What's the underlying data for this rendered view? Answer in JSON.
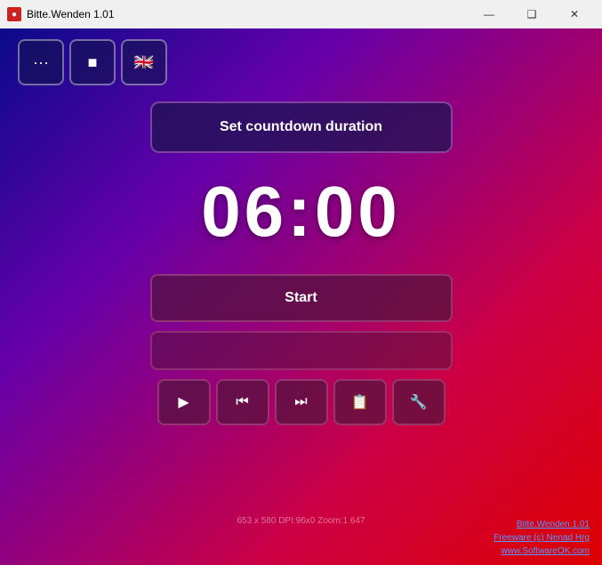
{
  "window": {
    "title": "Bitte.Wenden 1.01",
    "icon": "🔴"
  },
  "titlebar": {
    "minimize_label": "—",
    "maximize_label": "❑",
    "close_label": "✕"
  },
  "toolbar": {
    "btn1_icon": "···",
    "btn2_icon": "■",
    "btn3_icon": "🇬🇧"
  },
  "main": {
    "set_countdown_label": "Set countdown duration",
    "timer": "06:00",
    "start_label": "Start",
    "status_text": "653 x 580  DPI:96x0  Zoom:1  647"
  },
  "controls": {
    "play_icon": "▶",
    "skip_back_icon": "⏮",
    "skip_fwd_icon": "⏭",
    "clipboard_icon": "📋",
    "settings_icon": "🔧"
  },
  "footer": {
    "line1": "Bitte.Wenden 1.01",
    "line2": "Freeware (c) Nenad Hrg",
    "line3": "www.SoftwareOK.com"
  }
}
